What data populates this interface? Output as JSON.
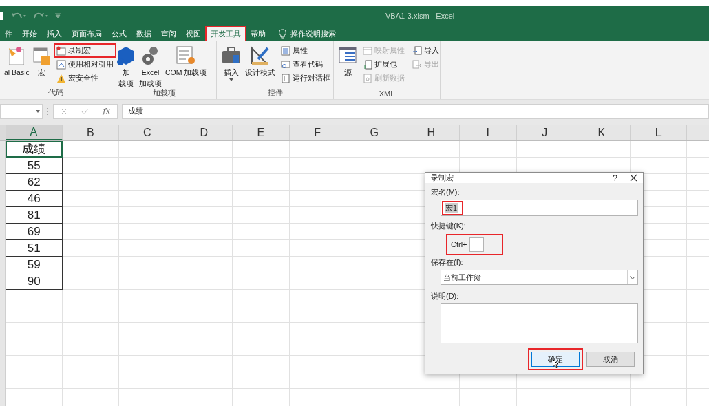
{
  "window": {
    "title": "VBA1-3.xlsm  -  Excel"
  },
  "tabs": [
    {
      "label": "件",
      "selected": false,
      "highlighted": false
    },
    {
      "label": "开始",
      "selected": false,
      "highlighted": false
    },
    {
      "label": "插入",
      "selected": false,
      "highlighted": false
    },
    {
      "label": "页面布局",
      "selected": false,
      "highlighted": false
    },
    {
      "label": "公式",
      "selected": false,
      "highlighted": false
    },
    {
      "label": "数据",
      "selected": false,
      "highlighted": false
    },
    {
      "label": "审阅",
      "selected": false,
      "highlighted": false
    },
    {
      "label": "视图",
      "selected": false,
      "highlighted": false
    },
    {
      "label": "开发工具",
      "selected": true,
      "highlighted": true
    },
    {
      "label": "帮助",
      "selected": false,
      "highlighted": false
    }
  ],
  "tell_me": "操作说明搜索",
  "ribbon": [
    {
      "label": "代码",
      "columns": [
        {
          "kind": "large",
          "lines": [
            "al Basic"
          ]
        },
        {
          "kind": "large",
          "lines": [
            "宏"
          ]
        },
        {
          "kind": "stack",
          "items": [
            {
              "label": "录制宏",
              "disabled": false,
              "highlighted": true
            },
            {
              "label": "使用相对引用",
              "disabled": false,
              "highlighted": false
            },
            {
              "label": "宏安全性",
              "disabled": false,
              "highlighted": false
            }
          ]
        }
      ]
    },
    {
      "label": "加载项",
      "columns": [
        {
          "kind": "large",
          "lines": [
            "加",
            "载项"
          ]
        },
        {
          "kind": "large",
          "lines": [
            "Excel",
            "加载项"
          ]
        },
        {
          "kind": "large",
          "lines": [
            "COM 加载项"
          ]
        }
      ]
    },
    {
      "label": "控件",
      "columns": [
        {
          "kind": "large",
          "lines": [
            "插入"
          ],
          "dropdown": true
        },
        {
          "kind": "large",
          "lines": [
            "设计模式"
          ]
        },
        {
          "kind": "stack",
          "items": [
            {
              "label": "属性",
              "disabled": false,
              "highlighted": false
            },
            {
              "label": "查看代码",
              "disabled": false,
              "highlighted": false
            },
            {
              "label": "运行对话框",
              "disabled": false,
              "highlighted": false
            }
          ]
        }
      ]
    },
    {
      "label": "XML",
      "columns": [
        {
          "kind": "large",
          "lines": [
            "源"
          ]
        },
        {
          "kind": "stack",
          "items": [
            {
              "label": "映射属性",
              "disabled": true,
              "highlighted": false
            },
            {
              "label": "扩展包",
              "disabled": false,
              "highlighted": false
            },
            {
              "label": "刷新数据",
              "disabled": true,
              "highlighted": false
            }
          ]
        },
        {
          "kind": "stack",
          "items": [
            {
              "label": "导入",
              "disabled": false,
              "highlighted": false
            },
            {
              "label": "导出",
              "disabled": true,
              "highlighted": false
            }
          ]
        }
      ]
    }
  ],
  "formula_bar": {
    "fx": "fx",
    "value": "成绩"
  },
  "columns": [
    {
      "label": "A",
      "selected": true
    },
    {
      "label": "B",
      "selected": false
    },
    {
      "label": "C",
      "selected": false
    },
    {
      "label": "D",
      "selected": false
    },
    {
      "label": "E",
      "selected": false
    },
    {
      "label": "F",
      "selected": false
    },
    {
      "label": "G",
      "selected": false
    },
    {
      "label": "H",
      "selected": false
    },
    {
      "label": "I",
      "selected": false
    },
    {
      "label": "J",
      "selected": false
    },
    {
      "label": "K",
      "selected": false
    },
    {
      "label": "L",
      "selected": false
    }
  ],
  "column_a": [
    "成绩",
    "55",
    "62",
    "46",
    "81",
    "69",
    "51",
    "59",
    "90"
  ],
  "dialog": {
    "title": "录制宏",
    "help": "?",
    "name_label": "宏名(M):",
    "name_value": "宏1",
    "name_highlighted": true,
    "shortcut_label": "快捷键(K):",
    "shortcut_prefix": "Ctrl+",
    "shortcut_highlighted": true,
    "store_label": "保存在(I):",
    "store_value": "当前工作簿",
    "description_label": "说明(D):",
    "buttons": [
      {
        "label": "确定",
        "default": true,
        "highlighted": true
      },
      {
        "label": "取消",
        "default": false,
        "highlighted": false
      }
    ]
  }
}
